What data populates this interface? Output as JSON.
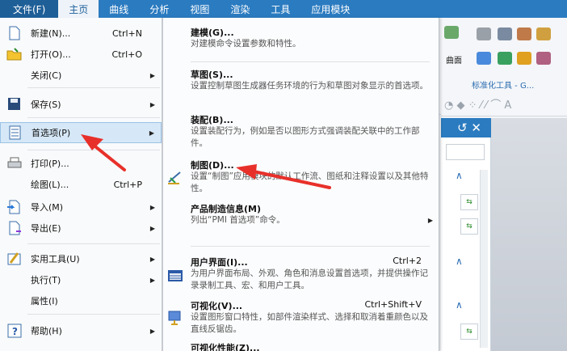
{
  "menubar": {
    "items": [
      "文件(F)",
      "主页",
      "曲线",
      "分析",
      "视图",
      "渲染",
      "工具",
      "应用模块"
    ]
  },
  "file_menu": {
    "items": [
      {
        "label": "新建(N)...",
        "shortcut": "Ctrl+N",
        "submenu": false,
        "icon": "new-file-icon"
      },
      {
        "label": "打开(O)...",
        "shortcut": "Ctrl+O",
        "submenu": false,
        "icon": "open-folder-icon"
      },
      {
        "label": "关闭(C)",
        "shortcut": "",
        "submenu": true,
        "icon": ""
      },
      {
        "label": "保存(S)",
        "shortcut": "",
        "submenu": true,
        "icon": "save-icon"
      },
      {
        "label": "首选项(P)",
        "shortcut": "",
        "submenu": true,
        "icon": "preferences-icon",
        "selected": true
      },
      {
        "label": "打印(P)...",
        "shortcut": "",
        "submenu": false,
        "icon": "print-icon"
      },
      {
        "label": "绘图(L)...",
        "shortcut": "Ctrl+P",
        "submenu": false,
        "icon": ""
      },
      {
        "label": "导入(M)",
        "shortcut": "",
        "submenu": true,
        "icon": "import-icon"
      },
      {
        "label": "导出(E)",
        "shortcut": "",
        "submenu": true,
        "icon": "export-icon"
      },
      {
        "label": "实用工具(U)",
        "shortcut": "",
        "submenu": true,
        "icon": "utilities-icon"
      },
      {
        "label": "执行(T)",
        "shortcut": "",
        "submenu": true,
        "icon": ""
      },
      {
        "label": "属性(I)",
        "shortcut": "",
        "submenu": false,
        "icon": ""
      },
      {
        "label": "帮助(H)",
        "shortcut": "",
        "submenu": true,
        "icon": "help-icon"
      }
    ]
  },
  "sub_menu": {
    "items": [
      {
        "title": "建模(G)...",
        "desc": "对建模命令设置参数和特性。",
        "shortcut": "",
        "icon": ""
      },
      {
        "title": "草图(S)...",
        "desc": "设置控制草图生成器任务环境的行为和草图对象显示的首选项。",
        "shortcut": "",
        "icon": ""
      },
      {
        "title": "装配(B)...",
        "desc": "设置装配行为，例如是否以图形方式强调装配关联中的工作部件。",
        "shortcut": "",
        "icon": ""
      },
      {
        "title": "制图(D)...",
        "desc": "设置“制图”应用模块的默认工作流、图纸和注释设置以及其他特性。",
        "shortcut": "",
        "icon": "drafting-icon"
      },
      {
        "title": "产品制造信息(M)",
        "desc": "列出“PMI 首选项”命令。",
        "shortcut": "",
        "icon": ""
      },
      {
        "title": "用户界面(I)...",
        "desc": "为用户界面布局、外观、角色和消息设置首选项，并提供操作记录录制工具、宏、和用户工具。",
        "shortcut": "Ctrl+2",
        "icon": "user-interface-icon"
      },
      {
        "title": "可视化(V)...",
        "desc": "设置图形窗口特性，如部件渲染样式、选择和取消着重颜色以及直线反锯齿。",
        "shortcut": "Ctrl+Shift+V",
        "icon": "visualization-icon"
      },
      {
        "title": "可视化性能(Z)...",
        "desc": "",
        "shortcut": "",
        "icon": ""
      }
    ]
  },
  "background": {
    "surface_label": "曲面",
    "standard_toolbar": "标准化工具 - G...",
    "close_glyph": "↺ ✕"
  },
  "colors": {
    "menubar": "#2b7bc0",
    "selected": "#d6e8f7",
    "annotation": "#e8302a"
  }
}
